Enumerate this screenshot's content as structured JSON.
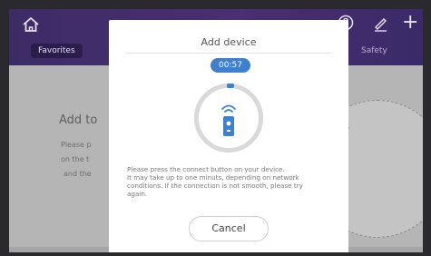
{
  "header": {
    "tabs": [
      {
        "label": "Favorites"
      },
      {
        "label": "Safety"
      }
    ]
  },
  "background_page": {
    "title": "Add to",
    "lines": [
      "Please p",
      "on the t",
      "and the"
    ]
  },
  "dialog": {
    "title": "Add device",
    "timer": "00:57",
    "message_lines": [
      "Please press the connect button on your device.",
      "It may take up to one minuts, depending on network",
      "conditions. If the connection is not smooth, please try",
      "again."
    ],
    "cancel_label": "Cancel"
  },
  "colors": {
    "header": "#4a2f72",
    "accent": "#3e7fd0",
    "overlay": "#b5b5b5"
  },
  "icons": [
    "home-icon",
    "help-icon",
    "edit-icon",
    "plus-icon",
    "wifi-icon",
    "remote-device-icon"
  ]
}
